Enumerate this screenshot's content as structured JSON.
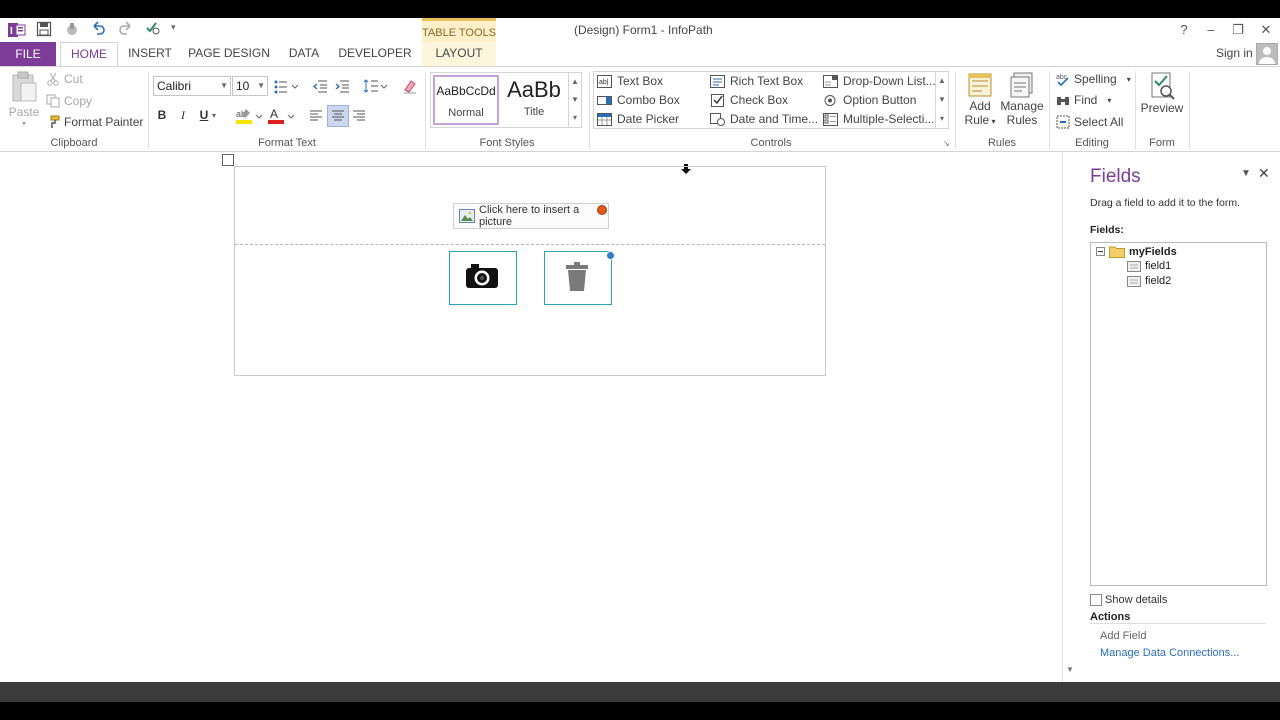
{
  "window": {
    "title": "(Design) Form1 - InfoPath",
    "contextual_tab_group": "TABLE TOOLS",
    "help": "?",
    "minimize": "–",
    "restore": "❐",
    "close": "✕"
  },
  "tabs": {
    "file": "FILE",
    "home": "HOME",
    "insert": "INSERT",
    "page_design": "PAGE DESIGN",
    "data": "DATA",
    "developer": "DEVELOPER",
    "layout": "LAYOUT",
    "sign_in": "Sign in"
  },
  "ribbon": {
    "clipboard": {
      "label": "Clipboard",
      "paste": "Paste",
      "cut": "Cut",
      "copy": "Copy",
      "format_painter": "Format Painter"
    },
    "format_text": {
      "label": "Format Text",
      "font": "Calibri",
      "size": "10",
      "bold": "B",
      "italic": "I",
      "underline": "U"
    },
    "font_styles": {
      "label": "Font Styles",
      "normal_preview": "AaBbCcDd",
      "normal": "Normal",
      "title_preview": "AaBb",
      "title": "Title"
    },
    "controls": {
      "label": "Controls",
      "items": [
        "Text Box",
        "Combo Box",
        "Date Picker",
        "Rich Text Box",
        "Check Box",
        "Date and Time...",
        "Drop-Down List...",
        "Option Button",
        "Multiple-Selecti..."
      ]
    },
    "rules": {
      "label": "Rules",
      "add_rule_line1": "Add",
      "add_rule_line2": "Rule",
      "manage_rules_line1": "Manage",
      "manage_rules_line2": "Rules"
    },
    "editing": {
      "label": "Editing",
      "spelling": "Spelling",
      "find": "Find",
      "select_all": "Select All"
    },
    "form": {
      "label": "Form",
      "preview": "Preview"
    }
  },
  "canvas": {
    "insert_picture": "Click here to insert a picture"
  },
  "fields_pane": {
    "title": "Fields",
    "instruction": "Drag a field to add it to the form.",
    "fields_label": "Fields:",
    "tree": {
      "root": "myFields",
      "children": [
        "field1",
        "field2"
      ]
    },
    "show_details": "Show details",
    "actions_label": "Actions",
    "add_field": "Add Field",
    "manage_connections": "Manage Data Connections..."
  },
  "colors": {
    "accent": "#7d3c98",
    "table_tools": "#fdf0c8",
    "picture_border": "#2aa3b8",
    "link": "#2a6ebb"
  }
}
